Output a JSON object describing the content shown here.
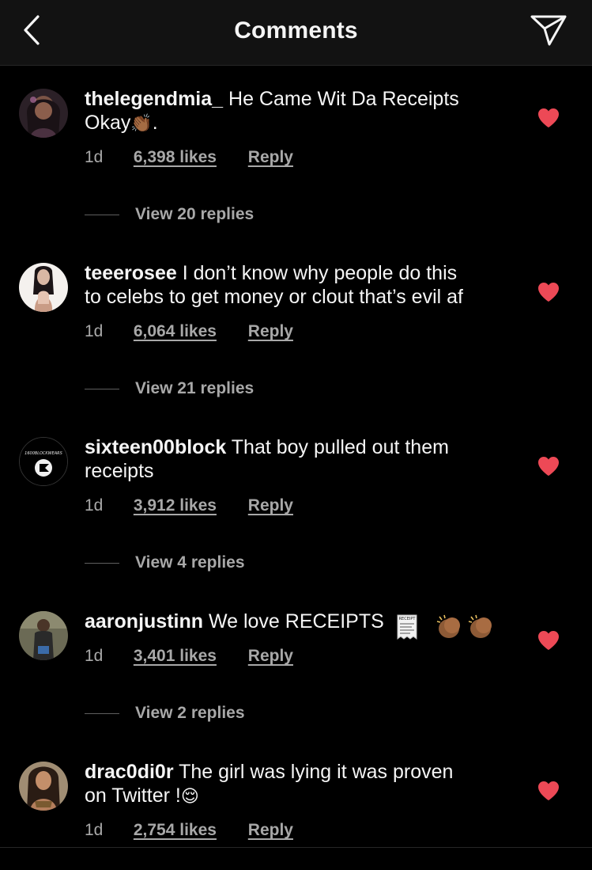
{
  "header": {
    "title": "Comments",
    "back_icon": "chevron-left-icon",
    "send_icon": "paper-plane-icon"
  },
  "colors": {
    "background": "#000000",
    "header_bg": "#121212",
    "text": "#f5f5f5",
    "secondary_text": "#a8a8a8",
    "heart": "#ed4956"
  },
  "comments": [
    {
      "username": "thelegendmia_",
      "text_line1": "He Came Wit Da Receipts",
      "text_line2": "Okay",
      "emoji": "👏🏾",
      "text_suffix": ".",
      "time": "1d",
      "likes": "6,398 likes",
      "reply": "Reply",
      "view_replies": "View 20 replies",
      "liked": true
    },
    {
      "username": "teeerosee",
      "text_line1": "I don’t know why people do this",
      "text_line2": "to celebs to get money or clout that’s evil af",
      "time": "1d",
      "likes": "6,064 likes",
      "reply": "Reply",
      "view_replies": "View 21 replies",
      "liked": true
    },
    {
      "username": "sixteen00block",
      "text_line1": "That boy pulled out them",
      "text_line2": "receipts",
      "avatar_text": "1600BLOCKWEARS",
      "time": "1d",
      "likes": "3,912 likes",
      "reply": "Reply",
      "view_replies": "View 4 replies",
      "liked": true
    },
    {
      "username": "aaronjustinn",
      "text_line1": "We love RECEIPTS",
      "emoji": "🧾 👏🏾👏🏾",
      "receipt_text": "RECEIPT",
      "time": "1d",
      "likes": "3,401 likes",
      "reply": "Reply",
      "view_replies": "View 2 replies",
      "liked": true
    },
    {
      "username": "drac0di0r",
      "text_line1": "The girl was lying it was proven",
      "text_line2": "on Twitter !",
      "emoji": "😌",
      "time": "1d",
      "likes": "2,754 likes",
      "reply": "Reply",
      "liked": true
    }
  ]
}
